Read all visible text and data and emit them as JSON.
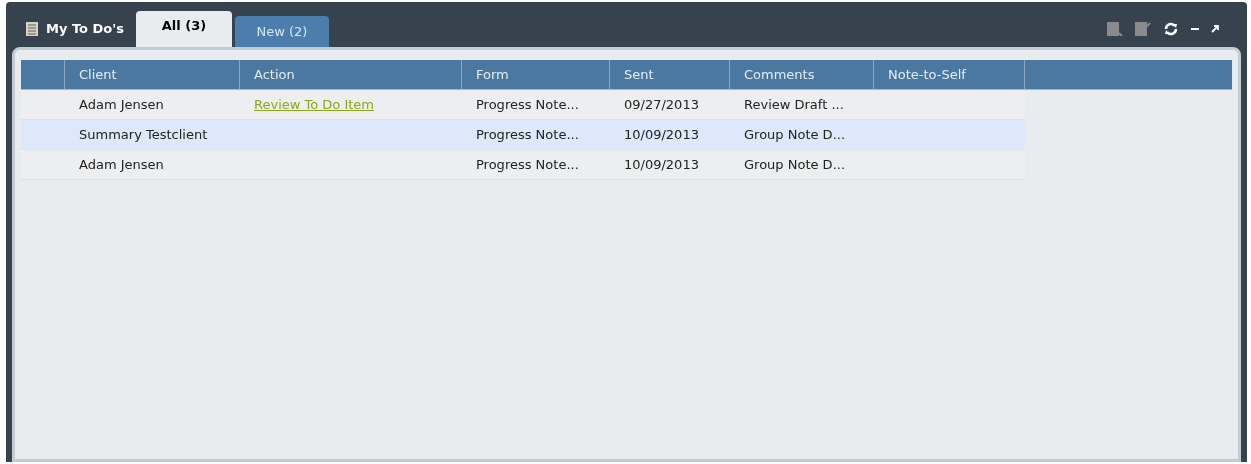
{
  "panel": {
    "title": "My To Do's"
  },
  "tabs": [
    {
      "label": "All (3)",
      "selected": true
    },
    {
      "label": "New (2)",
      "selected": false
    }
  ],
  "table": {
    "columns": [
      "Client",
      "Action",
      "Form",
      "Sent",
      "Comments",
      "Note-to-Self"
    ],
    "rows": [
      {
        "client": "Adam Jensen",
        "action": "Review To Do Item",
        "form": "Progress Note...",
        "sent": "09/27/2013",
        "comments": "Review Draft ...",
        "selected": false
      },
      {
        "client": "Summary Testclient",
        "form": "Progress Note...",
        "sent": "10/09/2013",
        "comments": "Group Note D...",
        "selected": true
      },
      {
        "client": "Adam Jensen",
        "form": "Progress Note...",
        "sent": "10/09/2013",
        "comments": "Group Note D...",
        "selected": false
      }
    ]
  }
}
